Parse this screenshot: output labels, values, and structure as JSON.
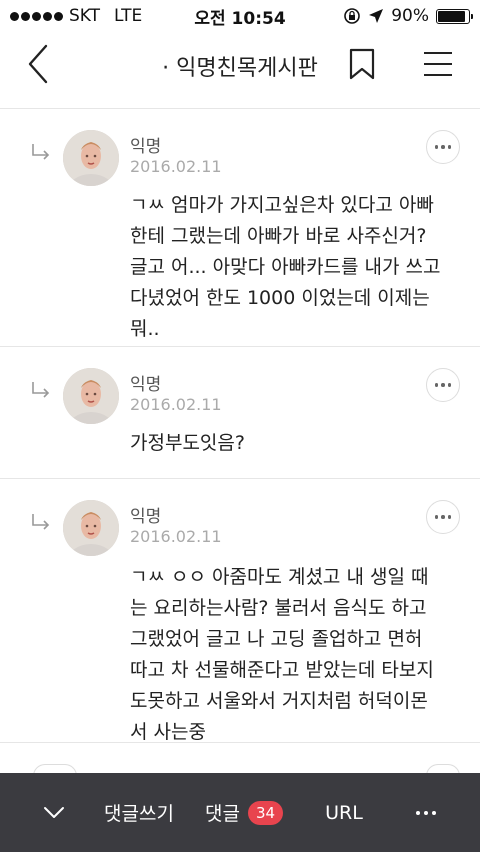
{
  "status_bar": {
    "carrier": "SKT",
    "network": "LTE",
    "time": "오전 10:54",
    "battery_percent": "90%",
    "battery_level": 0.9
  },
  "nav": {
    "title": "· 익명친목게시판"
  },
  "comments": [
    {
      "author": "익명",
      "date": "2016.02.11",
      "text": "ㄱㅆ 엄마가 가지고싶은차 있다고 아빠\n한테 그랬는데 아빠가 바로 사주신거?\n글고 어... 아맞다 아빠카드를 내가 쓰고\n다녔었어 한도 1000 이었는데 이제는\n뭐.."
    },
    {
      "author": "익명",
      "date": "2016.02.11",
      "text": "가정부도잇음?"
    },
    {
      "author": "익명",
      "date": "2016.02.11",
      "text": "ㄱㅆ ㅇㅇ 아줌마도 계셨고 내 생일 때\n는 요리하는사람? 불러서 음식도 하고\n그랬었어 글고 나 고딩 졸업하고 면허\n따고 차 선물해준다고 받았는데 타보지\n도못하고 서울와서 거지처럼 허덕이몬\n서 사는중"
    }
  ],
  "bottom_bar": {
    "write_comment_label": "댓글쓰기",
    "comments_label": "댓글",
    "comment_count": "34",
    "url_label": "URL"
  }
}
